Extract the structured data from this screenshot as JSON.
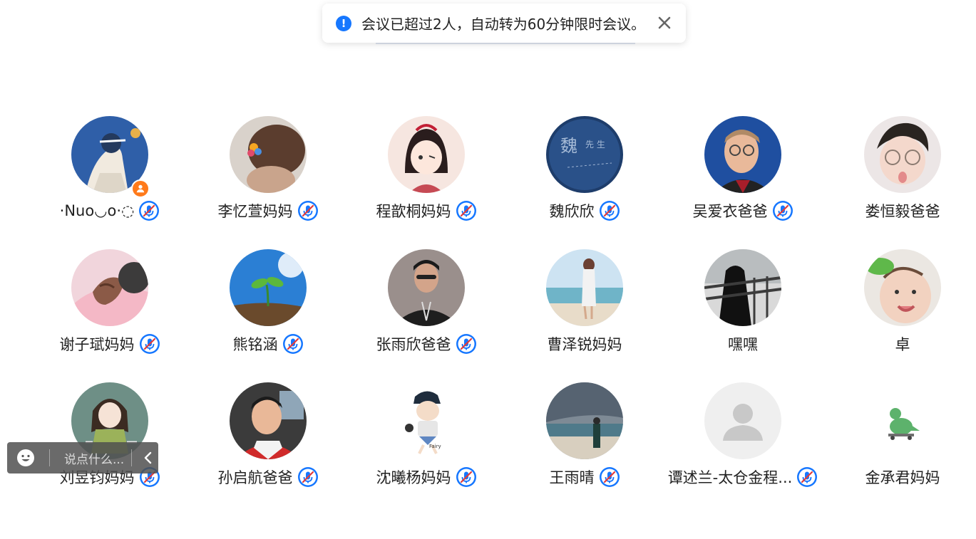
{
  "toast": {
    "message": "会议已超过2人，自动转为60分钟限时会议。",
    "icon": "alert-info-icon",
    "close_icon": "close-icon",
    "accent": "#1677ff"
  },
  "participants": [
    {
      "name": "·Nuo◡o·◌",
      "mic_muted": true,
      "host": true,
      "avatar": "avatar-illustration-girl"
    },
    {
      "name": "李忆萱妈妈",
      "mic_muted": true,
      "avatar": "avatar-photo-hair-clip"
    },
    {
      "name": "程歆桐妈妈",
      "mic_muted": true,
      "avatar": "avatar-anime-girl"
    },
    {
      "name": "魏欣欣",
      "mic_muted": true,
      "avatar": "avatar-dark-blue-calligraphy"
    },
    {
      "name": "吴爱衣爸爸",
      "mic_muted": true,
      "avatar": "avatar-photo-man-glasses"
    },
    {
      "name": "娄恒毅爸爸",
      "mic_muted": false,
      "avatar": "avatar-photo-baby-glasses"
    },
    {
      "name": "谢子珷妈妈",
      "mic_muted": true,
      "avatar": "avatar-photo-holding-hands"
    },
    {
      "name": "熊铭涵",
      "mic_muted": true,
      "avatar": "avatar-sky-sprout"
    },
    {
      "name": "张雨欣爸爸",
      "mic_muted": true,
      "avatar": "avatar-photo-man-jacket"
    },
    {
      "name": "曹泽锐妈妈",
      "mic_muted": false,
      "avatar": "avatar-photo-beach-woman"
    },
    {
      "name": "嘿嘿",
      "mic_muted": false,
      "avatar": "avatar-photo-dark-railing"
    },
    {
      "name": "卓",
      "mic_muted": false,
      "avatar": "avatar-photo-baby-smiling"
    },
    {
      "name": "刘昱钧妈妈",
      "mic_muted": true,
      "avatar": "avatar-illustration-doll-girl"
    },
    {
      "name": "孙启航爸爸",
      "mic_muted": true,
      "avatar": "avatar-photo-boy"
    },
    {
      "name": "沈曦杨妈妈",
      "mic_muted": true,
      "avatar": "avatar-cartoon-fairy-kid"
    },
    {
      "name": "王雨晴",
      "mic_muted": true,
      "avatar": "avatar-photo-stormy-beach"
    },
    {
      "name": "谭述兰-太仓金程...",
      "mic_muted": true,
      "avatar": "avatar-default-person"
    },
    {
      "name": "金承君妈妈",
      "mic_muted": false,
      "avatar": "avatar-cartoon-dinosaur"
    }
  ],
  "chat": {
    "placeholder": "说点什么...",
    "emoji_icon": "emoji-icon",
    "collapse_icon": "chevron-left-icon"
  },
  "colors": {
    "mic_muted": "#1677ff",
    "host_badge": "#ff7a1a"
  }
}
